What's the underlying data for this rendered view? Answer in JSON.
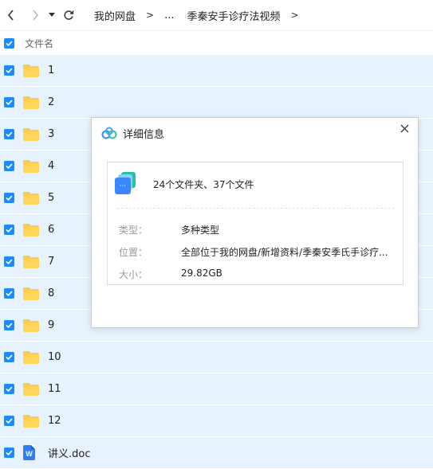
{
  "nav": {
    "back_icon": "chevron-left-icon",
    "forward_icon": "chevron-right-icon",
    "dropdown_icon": "caret-down-icon",
    "refresh_icon": "refresh-icon",
    "breadcrumb": [
      "我的网盘",
      "...",
      "季秦安手诊疗法视频"
    ],
    "separator": ">"
  },
  "header": {
    "name_label": "文件名"
  },
  "files": [
    {
      "name": "1",
      "type": "folder"
    },
    {
      "name": "2",
      "type": "folder"
    },
    {
      "name": "3",
      "type": "folder"
    },
    {
      "name": "4",
      "type": "folder"
    },
    {
      "name": "5",
      "type": "folder"
    },
    {
      "name": "6",
      "type": "folder"
    },
    {
      "name": "7",
      "type": "folder"
    },
    {
      "name": "8",
      "type": "folder"
    },
    {
      "name": "9",
      "type": "folder"
    },
    {
      "name": "10",
      "type": "folder"
    },
    {
      "name": "11",
      "type": "folder"
    },
    {
      "name": "12",
      "type": "folder"
    },
    {
      "name": "讲义.doc",
      "type": "doc",
      "icon_letter": "W"
    }
  ],
  "dialog": {
    "title": "详细信息",
    "summary": "24个文件夹、37个文件",
    "type_label": "类型：",
    "type_value": "多种类型",
    "location_label": "位置：",
    "location_value": "全部位于我的网盘/新增资料/季秦安季氏手诊疗...",
    "size_label": "大小：",
    "size_value": "29.82GB"
  },
  "colors": {
    "accent": "#1a8cff",
    "row_selected": "#e6f2fd",
    "folder": "#ffd044"
  }
}
